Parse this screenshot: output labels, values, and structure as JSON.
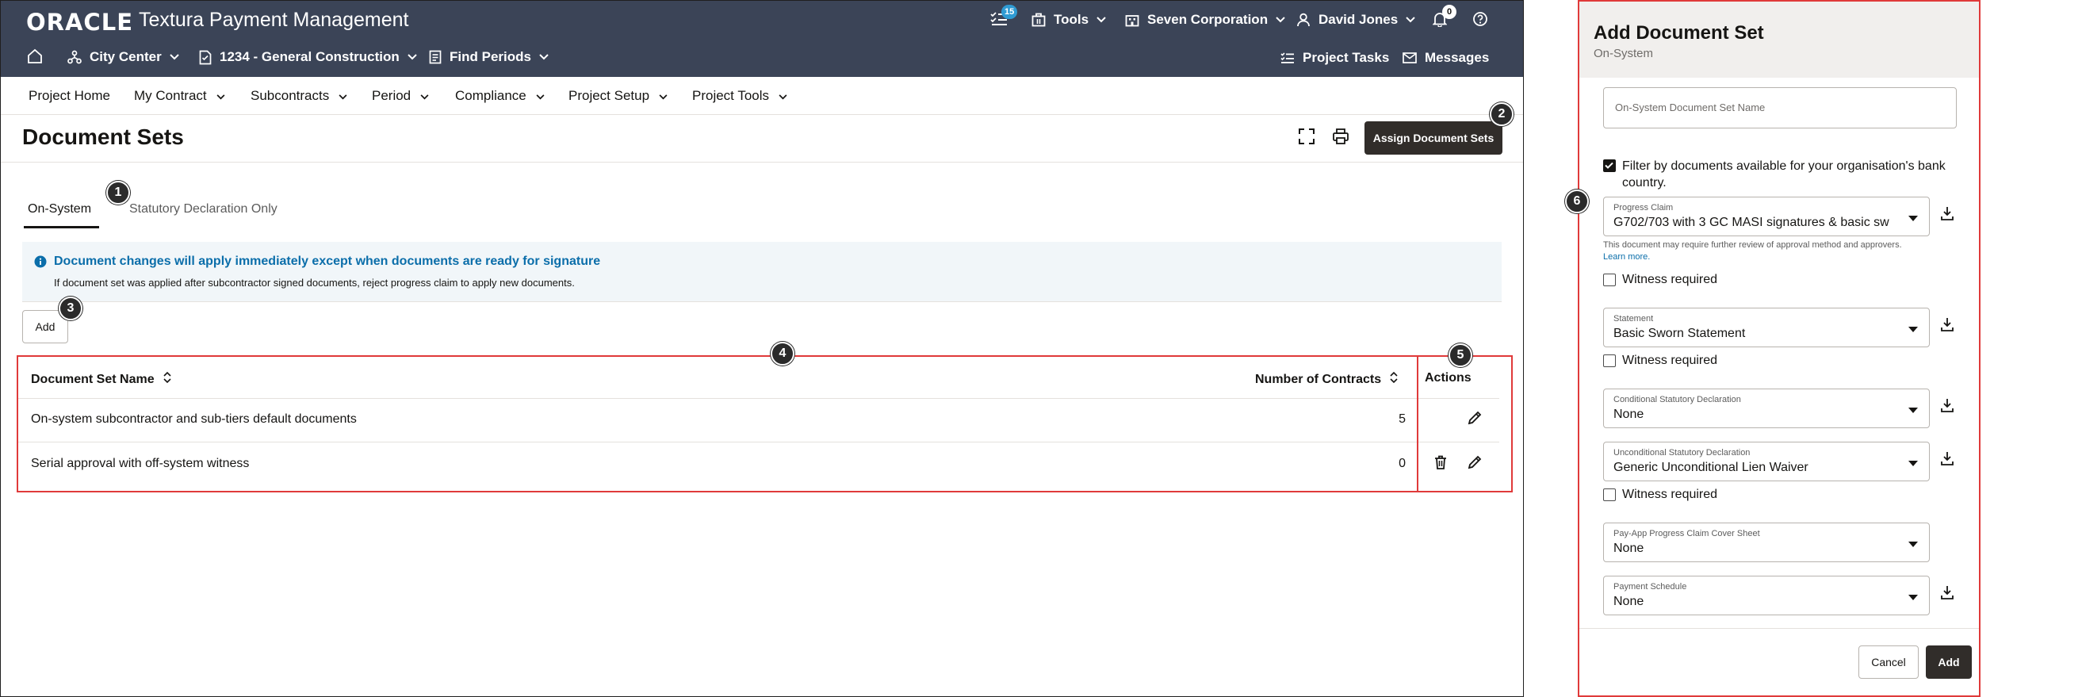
{
  "header": {
    "logo": "ORACLE",
    "app_title": "Textura Payment Management",
    "tasks_count": "15",
    "tools_label": "Tools",
    "company_label": "Seven Corporation",
    "user_label": "David Jones",
    "notifications_count": "0"
  },
  "subheader": {
    "location_label": "City Center",
    "project_label": "1234 - General Construction",
    "periods_label": "Find Periods",
    "project_tasks_label": "Project Tasks",
    "messages_label": "Messages"
  },
  "menu": {
    "items": [
      "Project Home",
      "My Contract",
      "Subcontracts",
      "Period",
      "Compliance",
      "Project Setup",
      "Project Tools"
    ]
  },
  "page": {
    "title": "Document Sets",
    "assign_button": "Assign Document Sets",
    "tabs": [
      "On-System",
      "Statutory Declaration Only"
    ],
    "info_title": "Document changes will apply immediately except when documents are ready for signature",
    "info_body": "If document set was applied after subcontractor signed documents, reject progress claim to apply new documents.",
    "add_button": "Add"
  },
  "table": {
    "columns": [
      "Document Set Name",
      "Number of Contracts",
      "Actions"
    ],
    "rows": [
      {
        "name": "On-system subcontractor and sub-tiers default documents",
        "contracts": "5"
      },
      {
        "name": "Serial approval with off-system witness",
        "contracts": "0"
      }
    ]
  },
  "callouts": [
    "1",
    "2",
    "3",
    "4",
    "5",
    "6"
  ],
  "drawer": {
    "title": "Add Document Set",
    "subtitle": "On-System",
    "name_placeholder": "On-System Document Set Name",
    "filter_label": "Filter by documents available for your organisation's bank country.",
    "fields": [
      {
        "label": "Progress Claim",
        "value": "G702/703 with 3 GC MASI signatures & basic sw"
      },
      {
        "label": "Statement",
        "value": "Basic Sworn Statement"
      },
      {
        "label": "Conditional Statutory Declaration",
        "value": "None"
      },
      {
        "label": "Unconditional Statutory Declaration",
        "value": "Generic Unconditional Lien Waiver"
      },
      {
        "label": "Pay-App Progress Claim Cover Sheet",
        "value": "None"
      },
      {
        "label": "Payment Schedule",
        "value": "None"
      }
    ],
    "note_text": "This document may require further review of approval method and approvers.",
    "note_link": "Learn more.",
    "witness_label": "Witness required",
    "cancel_button": "Cancel",
    "add_button": "Add"
  },
  "colors": {
    "header_bg": "#3b4457",
    "primary_button": "#312d2a",
    "highlight_border": "#e03a3a",
    "info_text": "#0b6eaa"
  }
}
